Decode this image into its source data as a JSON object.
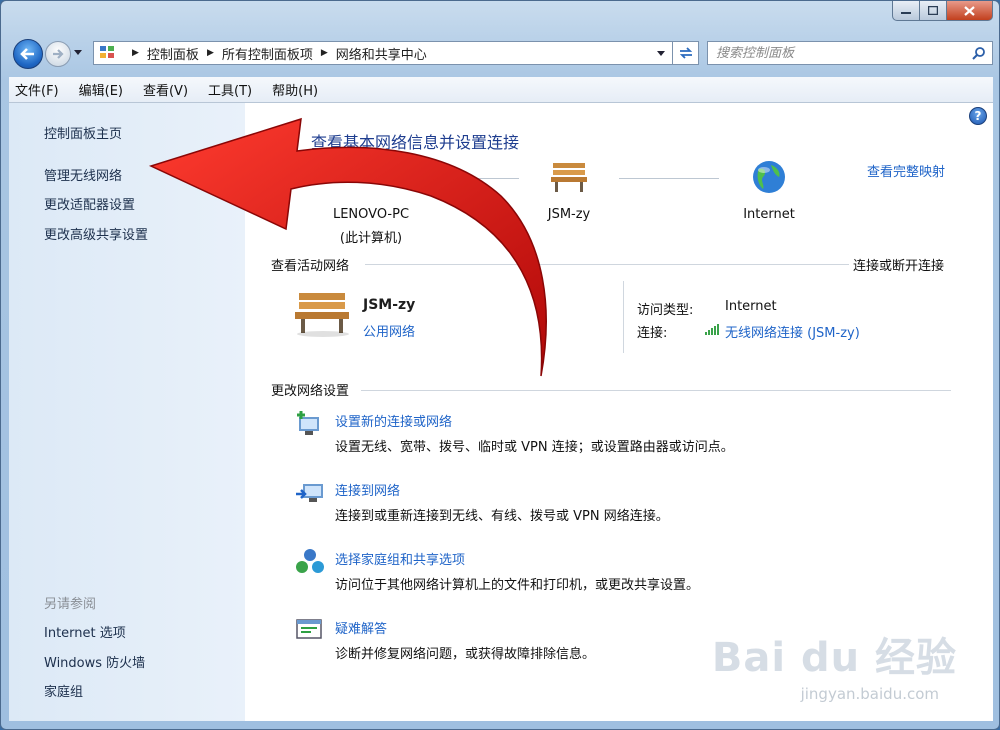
{
  "window": {
    "breadcrumbs": [
      "控制面板",
      "所有控制面板项",
      "网络和共享中心"
    ],
    "search_placeholder": "搜索控制面板"
  },
  "menu": [
    "文件(F)",
    "编辑(E)",
    "查看(V)",
    "工具(T)",
    "帮助(H)"
  ],
  "sidebar": {
    "links": [
      "控制面板主页",
      "管理无线网络",
      "更改适配器设置",
      "更改高级共享设置"
    ],
    "see_also_header": "另请参阅",
    "see_also": [
      "Internet 选项",
      "Windows 防火墙",
      "家庭组"
    ]
  },
  "main": {
    "title": "查看基本网络信息并设置连接",
    "full_map": "查看完整映射",
    "nodes": [
      {
        "name": "LENOVO-PC",
        "sub": "(此计算机)",
        "icon": "computer-icon"
      },
      {
        "name": "JSM-zy",
        "icon": "bench-icon"
      },
      {
        "name": "Internet",
        "icon": "globe-icon"
      }
    ],
    "active_header": "查看活动网络",
    "connect_disconnect": "连接或断开连接",
    "active_network": {
      "name": "JSM-zy",
      "type_link": "公用网络",
      "access_label": "访问类型:",
      "access_value": "Internet",
      "conn_label": "连接:",
      "conn_value": "无线网络连接 (JSM-zy)"
    },
    "change_header": "更改网络设置",
    "tasks": [
      {
        "title": "设置新的连接或网络",
        "desc": "设置无线、宽带、拨号、临时或 VPN 连接；或设置路由器或访问点。",
        "icon": "new-connection-icon"
      },
      {
        "title": "连接到网络",
        "desc": "连接到或重新连接到无线、有线、拨号或 VPN 网络连接。",
        "icon": "connect-network-icon"
      },
      {
        "title": "选择家庭组和共享选项",
        "desc": "访问位于其他网络计算机上的文件和打印机，或更改共享设置。",
        "icon": "homegroup-icon"
      },
      {
        "title": "疑难解答",
        "desc": "诊断并修复网络问题，或获得故障排除信息。",
        "icon": "troubleshoot-icon"
      }
    ]
  },
  "watermark": {
    "main": "Bai du 经验",
    "sub": "jingyan.baidu.com"
  },
  "colors": {
    "link": "#1f64c8",
    "title": "#1e3d8f",
    "arrow": "#d80f0f",
    "sidebar": "#dce9f6"
  }
}
